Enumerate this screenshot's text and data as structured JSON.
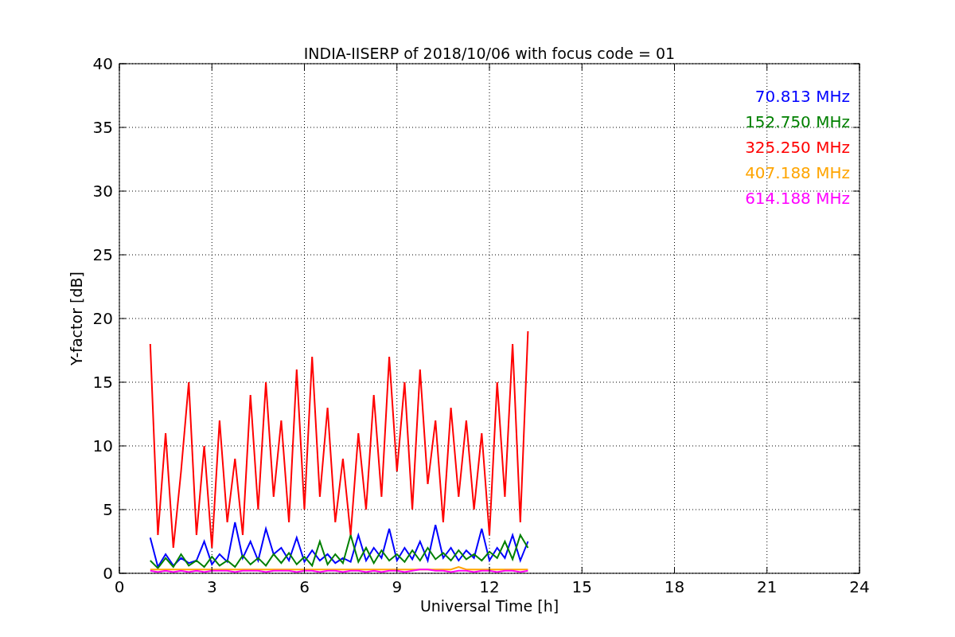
{
  "chart_data": {
    "type": "line",
    "title": "INDIA-IISERP of 2018/10/06 with focus code = 01",
    "xlabel": "Universal Time [h]",
    "ylabel": "Y-factor [dB]",
    "grid": true,
    "xlim": [
      0,
      24
    ],
    "ylim": [
      0,
      40
    ],
    "xticks": [
      0,
      3,
      6,
      9,
      12,
      15,
      18,
      21,
      24
    ],
    "yticks": [
      0,
      5,
      10,
      15,
      20,
      25,
      30,
      35,
      40
    ],
    "x": [
      1.0,
      1.25,
      1.5,
      1.75,
      2.0,
      2.25,
      2.5,
      2.75,
      3.0,
      3.25,
      3.5,
      3.75,
      4.0,
      4.25,
      4.5,
      4.75,
      5.0,
      5.25,
      5.5,
      5.75,
      6.0,
      6.25,
      6.5,
      6.75,
      7.0,
      7.25,
      7.5,
      7.75,
      8.0,
      8.25,
      8.5,
      8.75,
      9.0,
      9.25,
      9.5,
      9.75,
      10.0,
      10.25,
      10.5,
      10.75,
      11.0,
      11.25,
      11.5,
      11.75,
      12.0,
      12.25,
      12.5,
      12.75,
      13.0,
      13.25
    ],
    "series": [
      {
        "name": "70.813 MHz",
        "color": "#0000ff",
        "values": [
          2.8,
          0.5,
          1.5,
          0.6,
          1.2,
          0.8,
          1.0,
          2.5,
          0.7,
          1.5,
          0.9,
          4.0,
          1.2,
          2.5,
          1.0,
          3.5,
          1.5,
          2.0,
          1.0,
          2.8,
          0.9,
          1.8,
          1.0,
          1.5,
          0.8,
          1.2,
          0.9,
          3.0,
          1.0,
          2.0,
          1.2,
          3.5,
          1.0,
          2.0,
          1.1,
          2.5,
          1.0,
          3.8,
          1.2,
          2.0,
          1.0,
          1.8,
          1.2,
          3.5,
          1.0,
          2.0,
          1.2,
          3.0,
          1.0,
          2.5
        ]
      },
      {
        "name": "152.750 MHz",
        "color": "#008000",
        "values": [
          1.0,
          0.4,
          1.2,
          0.5,
          1.5,
          0.6,
          1.0,
          0.5,
          1.3,
          0.6,
          1.0,
          0.5,
          1.4,
          0.7,
          1.2,
          0.6,
          1.5,
          0.8,
          1.6,
          0.7,
          1.3,
          0.6,
          2.5,
          0.7,
          1.5,
          0.8,
          3.0,
          0.9,
          2.0,
          0.8,
          1.8,
          1.0,
          1.5,
          0.9,
          1.8,
          1.0,
          2.0,
          1.1,
          1.6,
          1.0,
          1.8,
          1.1,
          1.5,
          1.0,
          1.7,
          1.2,
          2.5,
          1.1,
          3.0,
          2.0
        ]
      },
      {
        "name": "325.250 MHz",
        "color": "#ff0000",
        "values": [
          18,
          3,
          11,
          2,
          8,
          15,
          3,
          10,
          2,
          12,
          4,
          9,
          3,
          14,
          5,
          15,
          6,
          12,
          4,
          16,
          5,
          17,
          6,
          13,
          4,
          9,
          3,
          11,
          5,
          14,
          6,
          17,
          8,
          15,
          5,
          16,
          7,
          12,
          4,
          13,
          6,
          12,
          5,
          11,
          3,
          15,
          6,
          18,
          4,
          19
        ]
      },
      {
        "name": "407.188 MHz",
        "color": "#ffa500",
        "values": [
          0.3,
          0.3,
          0.3,
          0.3,
          0.3,
          0.3,
          0.3,
          0.3,
          0.3,
          0.3,
          0.3,
          0.3,
          0.3,
          0.3,
          0.3,
          0.3,
          0.3,
          0.3,
          0.3,
          0.3,
          0.3,
          0.3,
          0.3,
          0.3,
          0.3,
          0.3,
          0.3,
          0.3,
          0.3,
          0.3,
          0.3,
          0.3,
          0.3,
          0.3,
          0.3,
          0.3,
          0.3,
          0.3,
          0.3,
          0.3,
          0.5,
          0.3,
          0.3,
          0.3,
          0.3,
          0.3,
          0.3,
          0.3,
          0.3,
          0.3
        ]
      },
      {
        "name": "614.188 MHz",
        "color": "#ff00ff",
        "values": [
          0.2,
          0.1,
          0.2,
          0.1,
          0.2,
          0.1,
          0.2,
          0.1,
          0.2,
          0.2,
          0.2,
          0.1,
          0.2,
          0.2,
          0.2,
          0.1,
          0.2,
          0.2,
          0.2,
          0.1,
          0.2,
          0.2,
          0.1,
          0.2,
          0.2,
          0.1,
          0.2,
          0.2,
          0.1,
          0.2,
          0.1,
          0.2,
          0.2,
          0.1,
          0.2,
          0.3,
          0.3,
          0.2,
          0.2,
          0.1,
          0.2,
          0.2,
          0.1,
          0.2,
          0.2,
          0.1,
          0.2,
          0.2,
          0.1,
          0.2
        ]
      }
    ]
  }
}
